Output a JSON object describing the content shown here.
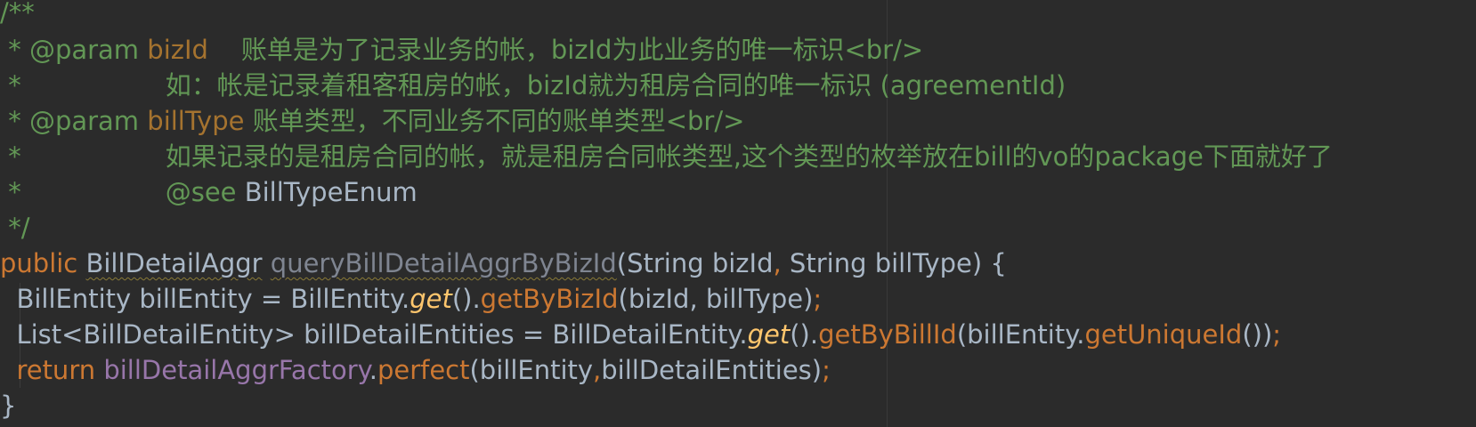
{
  "editor": {
    "comment": {
      "open": "/**",
      "param_tag": "@param",
      "see_tag": "@see",
      "close": " */",
      "star": " *",
      "bizId_name": "bizId",
      "bizId_desc": "账单是为了记录业务的帐，bizId为此业务的唯一标识<br/>",
      "bizId_example": "如：帐是记录着租客租房的帐，bizId就为租房合同的唯一标识 (agreementId)",
      "billType_name": "billType",
      "billType_desc": "账单类型，不同业务不同的账单类型<br/>",
      "billType_example": "如果记录的是租房合同的帐，就是租房合同帐类型,这个类型的枚举放在bill的vo的package下面就好了",
      "see_target": "BillTypeEnum"
    },
    "signature": {
      "modifier": "public",
      "return_type": "BillDetailAggr",
      "method_name": "queryBillDetailAggrByBizId",
      "params": "(String bizId",
      "comma": ",",
      "params2": " String billType) {"
    },
    "body": {
      "line1_decl": "BillEntity billEntity = BillEntity.",
      "line1_get": "get",
      "line1_mid": "().",
      "line1_call": "getByBizId",
      "line1_args": "(bizId, billType)",
      "line2_decl": "List<BillDetailEntity> billDetailEntities = BillDetailEntity.",
      "line2_get": "get",
      "line2_mid": "().",
      "line2_call": "getByBillId",
      "line2_args_open": "(billEntity.",
      "line2_inner_call": "getUniqueId",
      "line2_args_close": "())",
      "line3_return": "return",
      "line3_field": "billDetailAggrFactory",
      "line3_dot": ".",
      "line3_call": "perfect",
      "line3_args_a": "(billEntity",
      "line3_comma": ",",
      "line3_args_b": "billDetailEntities)",
      "semicolon": ";",
      "closing_brace": "}"
    },
    "colors": {
      "background": "#2b2b2b",
      "comment": "#629755",
      "doc_tag_value": "#a5732f",
      "keyword": "#cc7832",
      "text": "#a9b7c6",
      "method_highlight": "#ffc66d",
      "field": "#9876aa",
      "unused": "#7f8591"
    }
  }
}
